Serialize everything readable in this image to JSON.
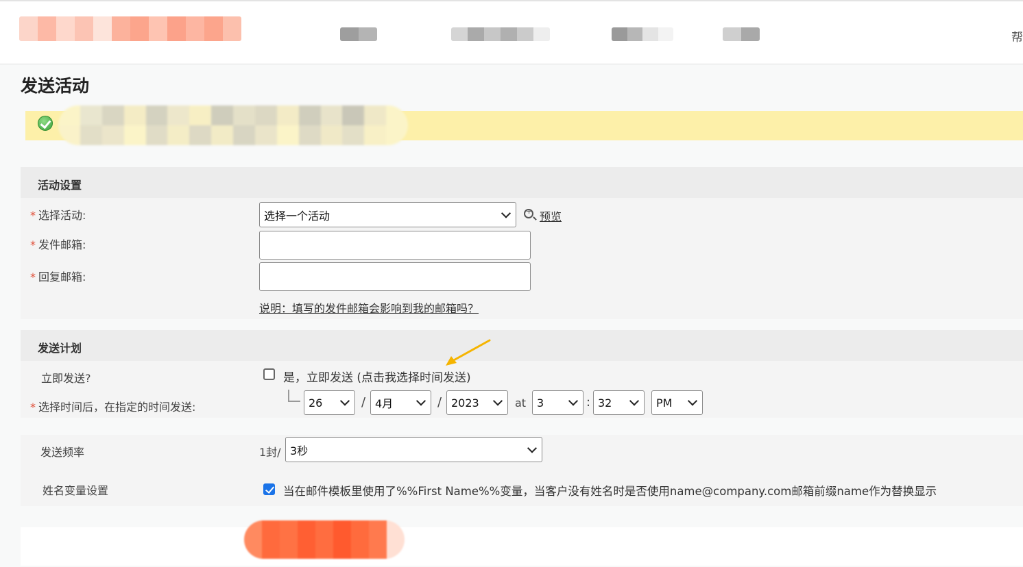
{
  "header": {
    "help_label": "帮"
  },
  "page": {
    "title": "发送活动"
  },
  "colors": {
    "accent_orange": "#ff6a3d",
    "notice_bg": "#fdf0a9",
    "arrow": "#f5b400",
    "check_blue": "#1a73e8"
  },
  "activity_settings": {
    "heading": "活动设置",
    "required_mark": "*",
    "select_label": "选择活动:",
    "select_value": "选择一个活动",
    "preview_label": "预览",
    "sender_label": "发件邮箱:",
    "sender_value": "",
    "reply_label": "回复邮箱:",
    "reply_value": "",
    "note_link": "说明：填写的发件邮箱会影响到我的邮箱吗？"
  },
  "schedule": {
    "heading": "发送计划",
    "immediate_label": "立即发送?",
    "immediate_option": "是，立即发送 (点击我选择时间发送)",
    "immediate_checked": false,
    "scheduled_label": "选择时间后，在指定的时间发送:",
    "day": "26",
    "month": "4月",
    "year": "2023",
    "at_label": "at",
    "hour": "3",
    "minute": "32",
    "ampm": "PM",
    "slash": "/",
    "colon": ":"
  },
  "frequency": {
    "label": "发送频率",
    "prefix": "1封/",
    "value": "3秒"
  },
  "name_variable": {
    "label": "姓名变量设置",
    "checked": true,
    "text": "当在邮件模板里使用了%%First Name%%变量，当客户没有姓名时是否使用name@company.com邮箱前缀name作为替换显示"
  }
}
